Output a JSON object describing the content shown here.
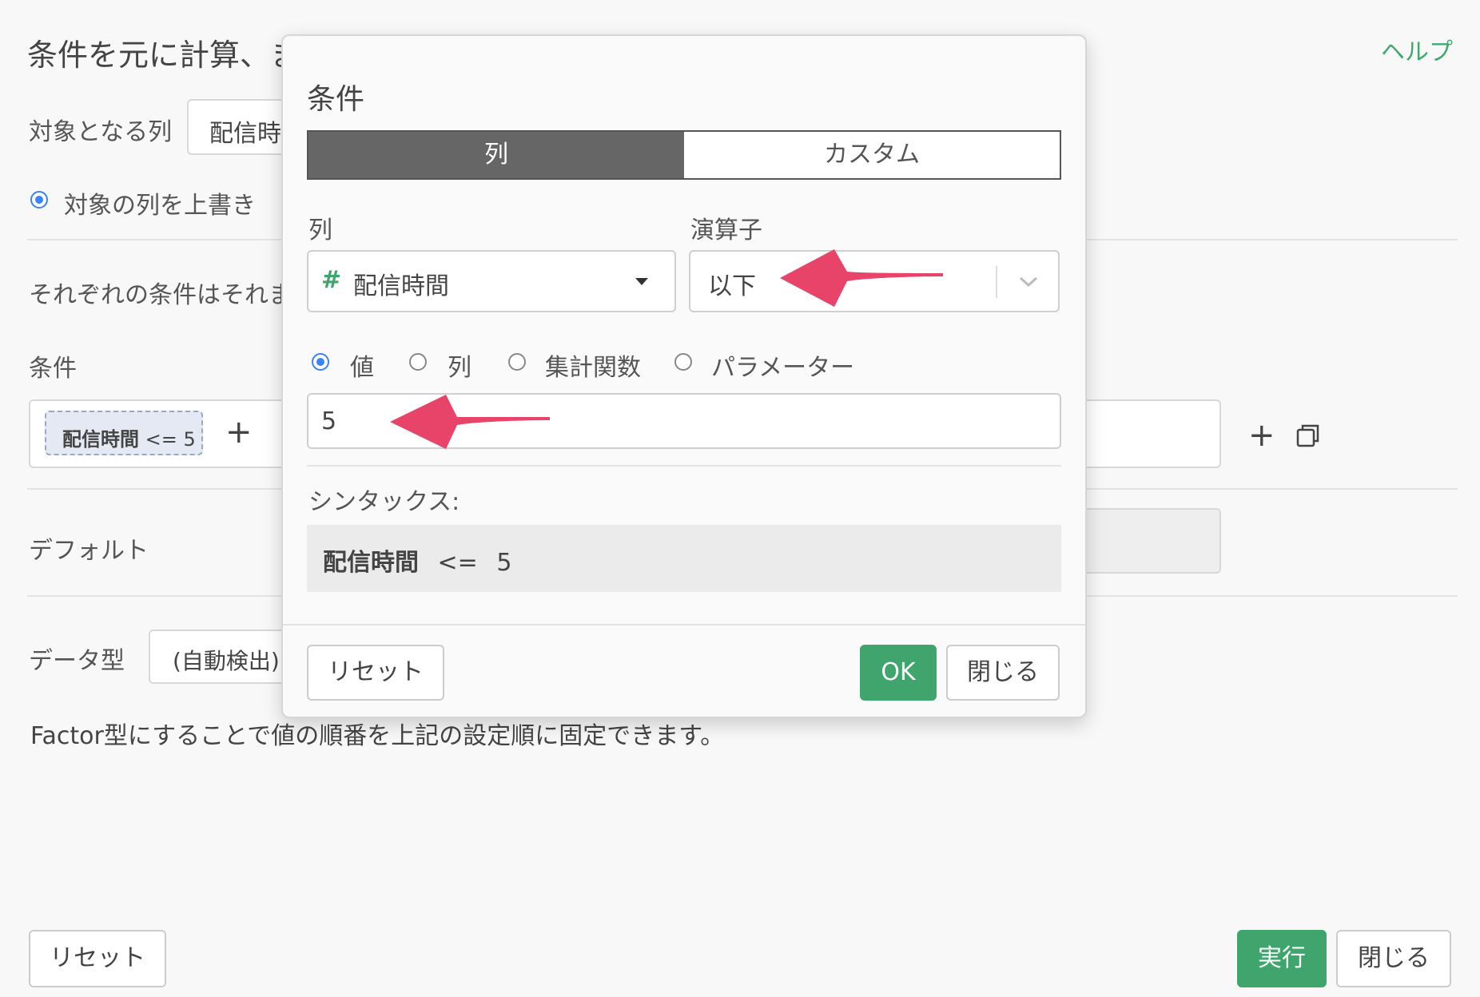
{
  "background": {
    "title": "条件を元に計算、ま",
    "help_link": "ヘルプ",
    "target_column_label": "対象となる列",
    "target_column_value": "配信時",
    "overwrite_option": "対象の列を上書き",
    "conditions_note": "それぞれの条件はそれま",
    "conditions_label": "条件",
    "condition_chip": {
      "column": "配信時間",
      "expr": "<= 5"
    },
    "add_condition": "+",
    "add_row": "+",
    "default_label": "デフォルト",
    "datatype_label": "データ型",
    "datatype_value": "(自動検出)",
    "factor_note": "Factor型にすることで値の順番を上記の設定順に固定できます。",
    "reset_button": "リセット",
    "run_button": "実行",
    "close_button": "閉じる"
  },
  "modal": {
    "title": "条件",
    "tabs": {
      "column": "列",
      "custom": "カスタム"
    },
    "column_label": "列",
    "operator_label": "演算子",
    "column_select_icon": "#",
    "column_select_value": "配信時間",
    "operator_select_value": "以下",
    "value_type_options": [
      "値",
      "列",
      "集計関数",
      "パラメーター"
    ],
    "value_input": "5",
    "syntax_label": "シンタックス:",
    "syntax": {
      "column": "配信時間",
      "operator": "<=",
      "value": "5"
    },
    "reset_button": "リセット",
    "ok_button": "OK",
    "close_button": "閉じる"
  },
  "colors": {
    "accent_green": "#3fa56c",
    "arrow": "#e8446a",
    "radio_blue": "#3b82f6"
  }
}
